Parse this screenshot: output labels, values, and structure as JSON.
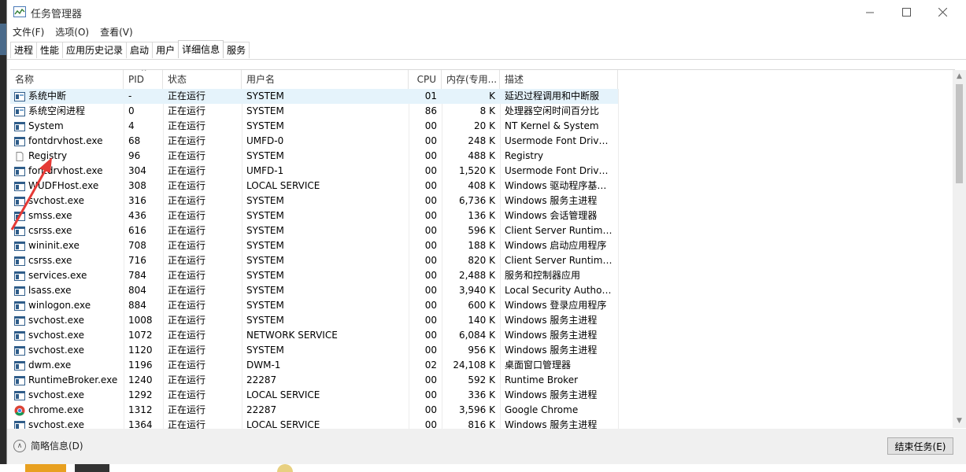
{
  "window": {
    "title": "任务管理器"
  },
  "menu": [
    "文件(F)",
    "选项(O)",
    "查看(V)"
  ],
  "tabs": [
    {
      "label": "进程",
      "active": false
    },
    {
      "label": "性能",
      "active": false
    },
    {
      "label": "应用历史记录",
      "active": false
    },
    {
      "label": "启动",
      "active": false
    },
    {
      "label": "用户",
      "active": false
    },
    {
      "label": "详细信息",
      "active": true
    },
    {
      "label": "服务",
      "active": false
    }
  ],
  "columns": {
    "name": "名称",
    "pid": "PID",
    "status": "状态",
    "user": "用户名",
    "cpu": "CPU",
    "mem": "内存(专用...",
    "desc": "描述"
  },
  "rows": [
    {
      "name": "系统中断",
      "pid": "-",
      "status": "正在运行",
      "user": "SYSTEM",
      "cpu": "01",
      "mem": "K",
      "desc": "延迟过程调用和中断服",
      "icon": "system-icon",
      "selected": true
    },
    {
      "name": "系统空闲进程",
      "pid": "0",
      "status": "正在运行",
      "user": "SYSTEM",
      "cpu": "86",
      "mem": "8 K",
      "desc": "处理器空闲时间百分比",
      "icon": "system-icon"
    },
    {
      "name": "System",
      "pid": "4",
      "status": "正在运行",
      "user": "SYSTEM",
      "cpu": "00",
      "mem": "20 K",
      "desc": "NT Kernel & System",
      "icon": "app-window-icon"
    },
    {
      "name": "fontdrvhost.exe",
      "pid": "68",
      "status": "正在运行",
      "user": "UMFD-0",
      "cpu": "00",
      "mem": "248 K",
      "desc": "Usermode Font Driver H",
      "icon": "app-window-icon"
    },
    {
      "name": "Registry",
      "pid": "96",
      "status": "正在运行",
      "user": "SYSTEM",
      "cpu": "00",
      "mem": "488 K",
      "desc": "Registry",
      "icon": "blank-file-icon"
    },
    {
      "name": "fontdrvhost.exe",
      "pid": "304",
      "status": "正在运行",
      "user": "UMFD-1",
      "cpu": "00",
      "mem": "1,520 K",
      "desc": "Usermode Font Driver H",
      "icon": "app-window-icon"
    },
    {
      "name": "WUDFHost.exe",
      "pid": "308",
      "status": "正在运行",
      "user": "LOCAL SERVICE",
      "cpu": "00",
      "mem": "408 K",
      "desc": "Windows 驱动程序基础 ...",
      "icon": "app-window-icon"
    },
    {
      "name": "svchost.exe",
      "pid": "316",
      "status": "正在运行",
      "user": "SYSTEM",
      "cpu": "00",
      "mem": "6,736 K",
      "desc": "Windows 服务主进程",
      "icon": "app-window-icon"
    },
    {
      "name": "smss.exe",
      "pid": "436",
      "status": "正在运行",
      "user": "SYSTEM",
      "cpu": "00",
      "mem": "136 K",
      "desc": "Windows 会话管理器",
      "icon": "app-window-icon"
    },
    {
      "name": "csrss.exe",
      "pid": "616",
      "status": "正在运行",
      "user": "SYSTEM",
      "cpu": "00",
      "mem": "596 K",
      "desc": "Client Server Runtime Pr...",
      "icon": "app-window-icon"
    },
    {
      "name": "wininit.exe",
      "pid": "708",
      "status": "正在运行",
      "user": "SYSTEM",
      "cpu": "00",
      "mem": "188 K",
      "desc": "Windows 启动应用程序",
      "icon": "app-window-icon"
    },
    {
      "name": "csrss.exe",
      "pid": "716",
      "status": "正在运行",
      "user": "SYSTEM",
      "cpu": "00",
      "mem": "820 K",
      "desc": "Client Server Runtime Pr...",
      "icon": "app-window-icon"
    },
    {
      "name": "services.exe",
      "pid": "784",
      "status": "正在运行",
      "user": "SYSTEM",
      "cpu": "00",
      "mem": "2,488 K",
      "desc": "服务和控制器应用",
      "icon": "app-window-icon"
    },
    {
      "name": "lsass.exe",
      "pid": "804",
      "status": "正在运行",
      "user": "SYSTEM",
      "cpu": "00",
      "mem": "3,940 K",
      "desc": "Local Security Authority...",
      "icon": "app-window-icon"
    },
    {
      "name": "winlogon.exe",
      "pid": "884",
      "status": "正在运行",
      "user": "SYSTEM",
      "cpu": "00",
      "mem": "600 K",
      "desc": "Windows 登录应用程序",
      "icon": "app-window-icon"
    },
    {
      "name": "svchost.exe",
      "pid": "1008",
      "status": "正在运行",
      "user": "SYSTEM",
      "cpu": "00",
      "mem": "140 K",
      "desc": "Windows 服务主进程",
      "icon": "app-window-icon"
    },
    {
      "name": "svchost.exe",
      "pid": "1072",
      "status": "正在运行",
      "user": "NETWORK SERVICE",
      "cpu": "00",
      "mem": "6,084 K",
      "desc": "Windows 服务主进程",
      "icon": "app-window-icon"
    },
    {
      "name": "svchost.exe",
      "pid": "1120",
      "status": "正在运行",
      "user": "SYSTEM",
      "cpu": "00",
      "mem": "956 K",
      "desc": "Windows 服务主进程",
      "icon": "app-window-icon"
    },
    {
      "name": "dwm.exe",
      "pid": "1196",
      "status": "正在运行",
      "user": "DWM-1",
      "cpu": "02",
      "mem": "24,108 K",
      "desc": "桌面窗口管理器",
      "icon": "app-window-icon"
    },
    {
      "name": "RuntimeBroker.exe",
      "pid": "1240",
      "status": "正在运行",
      "user": "22287",
      "cpu": "00",
      "mem": "592 K",
      "desc": "Runtime Broker",
      "icon": "app-window-icon"
    },
    {
      "name": "svchost.exe",
      "pid": "1292",
      "status": "正在运行",
      "user": "LOCAL SERVICE",
      "cpu": "00",
      "mem": "336 K",
      "desc": "Windows 服务主进程",
      "icon": "app-window-icon"
    },
    {
      "name": "chrome.exe",
      "pid": "1312",
      "status": "正在运行",
      "user": "22287",
      "cpu": "00",
      "mem": "3,596 K",
      "desc": "Google Chrome",
      "icon": "chrome-icon"
    },
    {
      "name": "svchost.exe",
      "pid": "1364",
      "status": "正在运行",
      "user": "LOCAL SERVICE",
      "cpu": "00",
      "mem": "816 K",
      "desc": "Windows 服务主进程",
      "icon": "app-window-icon"
    }
  ],
  "footer": {
    "less_details": "简略信息(D)",
    "end_task": "结束任务(E)"
  },
  "annotation": {
    "color": "#e53935"
  }
}
